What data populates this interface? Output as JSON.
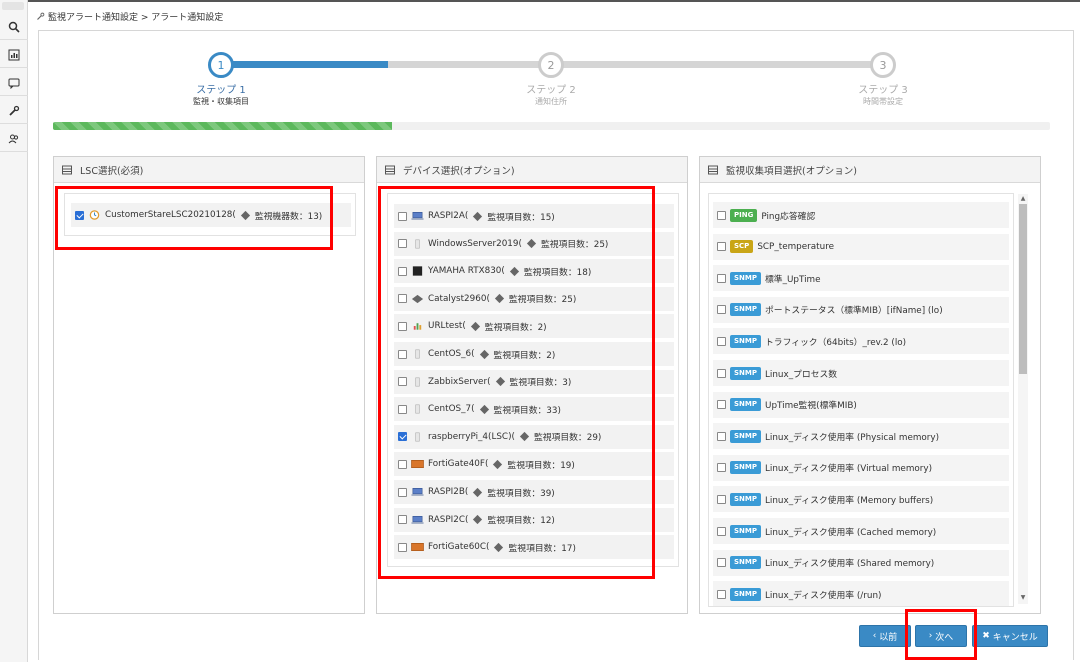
{
  "breadcrumb": "監視アラート通知設定 > アラート通知設定",
  "steps": [
    {
      "number": "1",
      "title": "ステップ 1",
      "subtitle": "監視・収集項目"
    },
    {
      "number": "2",
      "title": "ステップ 2",
      "subtitle": "通知住所"
    },
    {
      "number": "3",
      "title": "ステップ 3",
      "subtitle": "時間帯設定"
    }
  ],
  "progress_fraction": 0.34,
  "panels": {
    "lsc": {
      "title": "LSC選択(必須)",
      "items": [
        {
          "label": "CustomerStareLSC20210128(",
          "count_label": "監視機器数：13)",
          "checked": true
        }
      ]
    },
    "devices": {
      "title": "デバイス選択(オプション)",
      "items": [
        {
          "label": "RASPI2A(",
          "count_label": "監視項目数：15)",
          "checked": false,
          "icon": "laptop-icon"
        },
        {
          "label": "WindowsServer2019(",
          "count_label": "監視項目数：25)",
          "checked": false,
          "icon": "server-icon"
        },
        {
          "label": "YAMAHA RTX830(",
          "count_label": "監視項目数：18)",
          "checked": false,
          "icon": "router-icon"
        },
        {
          "label": "Catalyst2960(",
          "count_label": "監視項目数：25)",
          "checked": false,
          "icon": "switch-icon"
        },
        {
          "label": "URLtest(",
          "count_label": "監視項目数：2)",
          "checked": false,
          "icon": "chart-icon"
        },
        {
          "label": "CentOS_6(",
          "count_label": "監視項目数：2)",
          "checked": false,
          "icon": "server-icon"
        },
        {
          "label": "ZabbixServer(",
          "count_label": "監視項目数：3)",
          "checked": false,
          "icon": "server-icon"
        },
        {
          "label": "CentOS_7(",
          "count_label": "監視項目数：33)",
          "checked": false,
          "icon": "server-icon"
        },
        {
          "label": "raspberryPi_4(LSC)(",
          "count_label": "監視項目数：29)",
          "checked": true,
          "icon": "server-icon"
        },
        {
          "label": "FortiGate40F(",
          "count_label": "監視項目数：19)",
          "checked": false,
          "icon": "firewall-icon"
        },
        {
          "label": "RASPI2B(",
          "count_label": "監視項目数：39)",
          "checked": false,
          "icon": "laptop-icon"
        },
        {
          "label": "RASPI2C(",
          "count_label": "監視項目数：12)",
          "checked": false,
          "icon": "laptop-icon"
        },
        {
          "label": "FortiGate60C(",
          "count_label": "監視項目数：17)",
          "checked": false,
          "icon": "firewall-icon"
        }
      ]
    },
    "items": {
      "title": "監視収集項目選択(オプション)",
      "items": [
        {
          "badge": "PING",
          "badge_color": "#4caf50",
          "label": "Ping応答確認"
        },
        {
          "badge": "SCP",
          "badge_color": "#c9a516",
          "label": "SCP_temperature"
        },
        {
          "badge": "SNMP",
          "badge_color": "#3a9bd6",
          "label": "標準_UpTime"
        },
        {
          "badge": "SNMP",
          "badge_color": "#3a9bd6",
          "label": "ポートステータス（標準MIB）[ifName] (lo)"
        },
        {
          "badge": "SNMP",
          "badge_color": "#3a9bd6",
          "label": "トラフィック（64bits）_rev.2 (lo)"
        },
        {
          "badge": "SNMP",
          "badge_color": "#3a9bd6",
          "label": "Linux_プロセス数"
        },
        {
          "badge": "SNMP",
          "badge_color": "#3a9bd6",
          "label": "UpTime監視(標準MIB)"
        },
        {
          "badge": "SNMP",
          "badge_color": "#3a9bd6",
          "label": "Linux_ディスク使用率 (Physical memory)"
        },
        {
          "badge": "SNMP",
          "badge_color": "#3a9bd6",
          "label": "Linux_ディスク使用率 (Virtual memory)"
        },
        {
          "badge": "SNMP",
          "badge_color": "#3a9bd6",
          "label": "Linux_ディスク使用率 (Memory buffers)"
        },
        {
          "badge": "SNMP",
          "badge_color": "#3a9bd6",
          "label": "Linux_ディスク使用率 (Cached memory)"
        },
        {
          "badge": "SNMP",
          "badge_color": "#3a9bd6",
          "label": "Linux_ディスク使用率 (Shared memory)"
        },
        {
          "badge": "SNMP",
          "badge_color": "#3a9bd6",
          "label": "Linux_ディスク使用率 (/run)"
        }
      ]
    }
  },
  "buttons": {
    "prev": "以前",
    "next": "次へ",
    "cancel": "キャンセル"
  },
  "colors": {
    "accent": "#3a8ac5",
    "highlight": "#ff0000",
    "progress": "#5cb85c"
  }
}
